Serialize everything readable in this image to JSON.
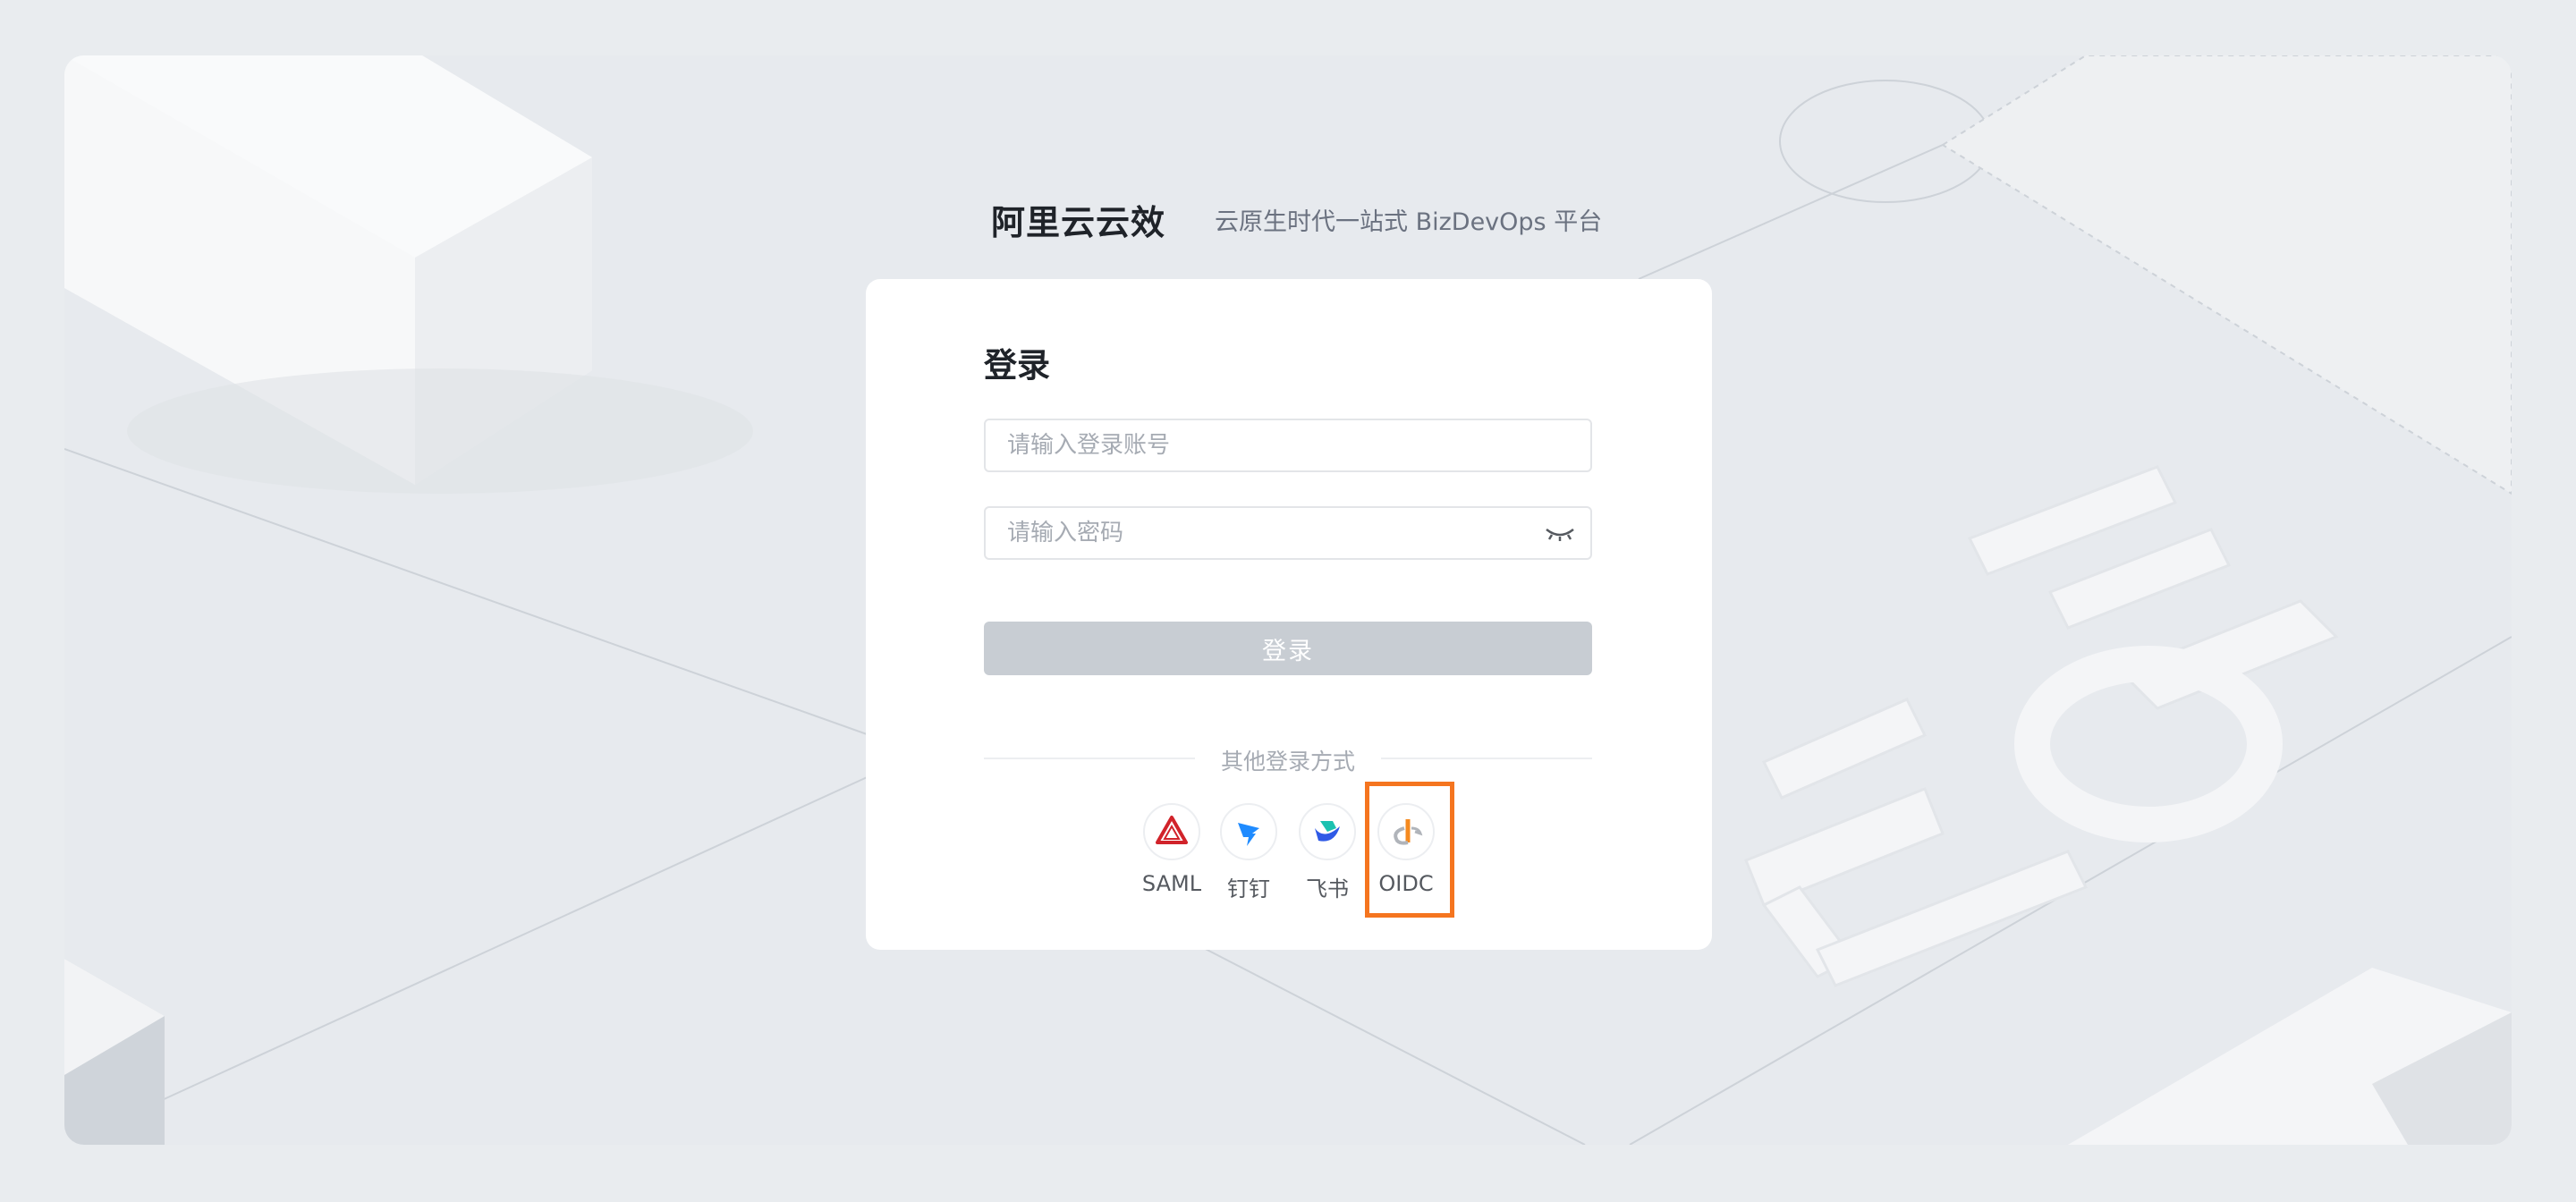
{
  "brand": {
    "title": "阿里云云效",
    "slogan": "云原生时代一站式 BizDevOps 平台"
  },
  "login": {
    "title": "登录",
    "account_placeholder": "请输入登录账号",
    "password_placeholder": "请输入密码",
    "submit_label": "登录",
    "other_methods_label": "其他登录方式"
  },
  "providers": [
    {
      "label": "SAML",
      "icon": "saml-icon"
    },
    {
      "label": "钉钉",
      "icon": "dingtalk-icon"
    },
    {
      "label": "飞书",
      "icon": "feishu-icon"
    },
    {
      "label": "OIDC",
      "icon": "oidc-icon"
    }
  ],
  "colors": {
    "page_bg": "#e9ecef",
    "card_bg": "#ffffff",
    "button_disabled": "#c8cdd3",
    "highlight": "#f5751f"
  }
}
